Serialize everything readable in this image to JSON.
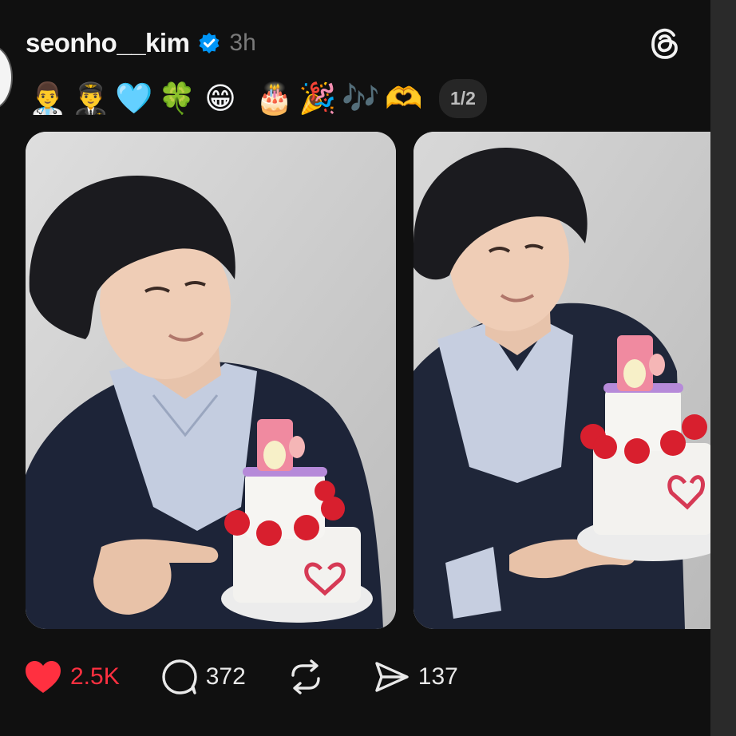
{
  "post": {
    "username": "seonho__kim",
    "time": "3h",
    "caption_emojis": [
      "👨‍⚕️",
      "👨‍✈️",
      "🩵",
      "🍀",
      "😁",
      "🎂",
      "🎉",
      "🎶",
      "🫶"
    ],
    "media_counter": "1/2"
  },
  "actions": {
    "likes": "2.5K",
    "comments": "372",
    "reposts": "",
    "shares": "137"
  },
  "colors": {
    "like_red": "#ff3040",
    "verified_blue": "#0095f6",
    "background": "#101010"
  },
  "icons": {
    "header": [
      "verified-badge-icon",
      "threads-logo-icon"
    ],
    "actions": [
      "heart-icon",
      "comment-icon",
      "repost-icon",
      "share-icon"
    ]
  }
}
